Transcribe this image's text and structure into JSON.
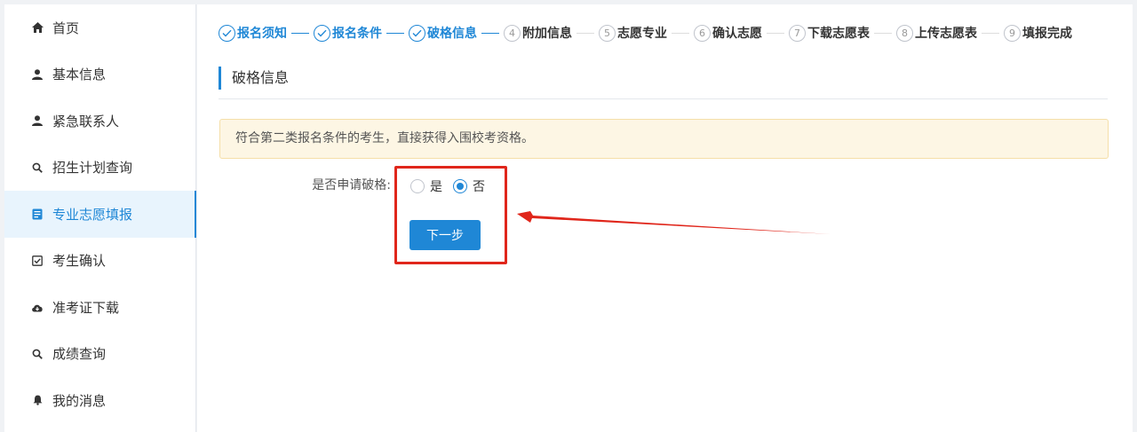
{
  "sidebar": {
    "items": [
      {
        "label": "首页",
        "icon": "home-icon",
        "active": false
      },
      {
        "label": "基本信息",
        "icon": "user-icon",
        "active": false
      },
      {
        "label": "紧急联系人",
        "icon": "user-icon",
        "active": false
      },
      {
        "label": "招生计划查询",
        "icon": "search-icon",
        "active": false
      },
      {
        "label": "专业志愿填报",
        "icon": "document-icon",
        "active": true
      },
      {
        "label": "考生确认",
        "icon": "checkbox-icon",
        "active": false
      },
      {
        "label": "准考证下载",
        "icon": "cloud-download-icon",
        "active": false
      },
      {
        "label": "成绩查询",
        "icon": "search-icon",
        "active": false
      },
      {
        "label": "我的消息",
        "icon": "bell-icon",
        "active": false
      }
    ]
  },
  "steps": [
    {
      "num": "",
      "label": "报名须知",
      "done": true
    },
    {
      "num": "",
      "label": "报名条件",
      "done": true
    },
    {
      "num": "",
      "label": "破格信息",
      "done": true
    },
    {
      "num": "4",
      "label": "附加信息",
      "done": false
    },
    {
      "num": "5",
      "label": "志愿专业",
      "done": false
    },
    {
      "num": "6",
      "label": "确认志愿",
      "done": false
    },
    {
      "num": "7",
      "label": "下载志愿表",
      "done": false
    },
    {
      "num": "8",
      "label": "上传志愿表",
      "done": false
    },
    {
      "num": "9",
      "label": "填报完成",
      "done": false
    }
  ],
  "section": {
    "title": "破格信息"
  },
  "notice": {
    "text": "符合第二类报名条件的考生，直接获得入围校考资格。"
  },
  "form": {
    "label": "是否申请破格:",
    "options": [
      {
        "label": "是",
        "checked": false
      },
      {
        "label": "否",
        "checked": true
      }
    ],
    "next_label": "下一步"
  },
  "colors": {
    "accent": "#1f87d6",
    "annotation": "#e0261b",
    "notice_bg": "#fdf6e4"
  }
}
